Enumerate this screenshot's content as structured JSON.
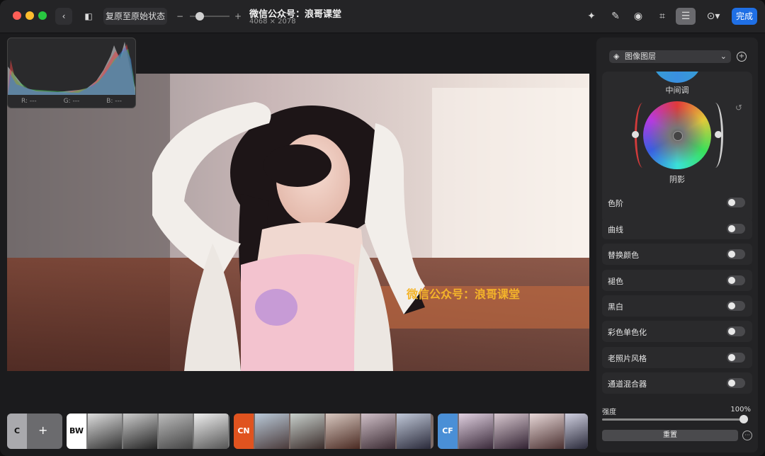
{
  "toolbar": {
    "revert_label": "复原至原始状态",
    "title": "微信公众号：浪哥课堂",
    "dimensions": "4068 × 2078",
    "done_label": "完成",
    "zoom_min_label": "−",
    "zoom_max_label": "+"
  },
  "histogram": {
    "r_label": "R: ---",
    "g_label": "G: ---",
    "b_label": "B: ---"
  },
  "watermark": "微信公众号：浪哥课堂",
  "panel": {
    "layer_select": "图像图层",
    "midtones_label": "中间调",
    "shadows_label": "阴影",
    "adjustments": [
      "色阶",
      "曲线",
      "替换颜色",
      "褪色",
      "黑白",
      "彩色单色化",
      "老照片风格",
      "通道混合器"
    ],
    "intensity_label": "强度",
    "intensity_value": "100%",
    "intensity_fraction": 1.0,
    "reset_label": "重置"
  },
  "filmstrip": [
    {
      "tag": "C",
      "color": "#8e8e93"
    },
    {
      "tag": "BW",
      "color": "#ffffff"
    },
    {
      "tag": "CN",
      "color": "#e0531f"
    },
    {
      "tag": "CF",
      "color": "#4a8fd6"
    }
  ],
  "colors": {
    "accent": "#1f6fe5"
  }
}
